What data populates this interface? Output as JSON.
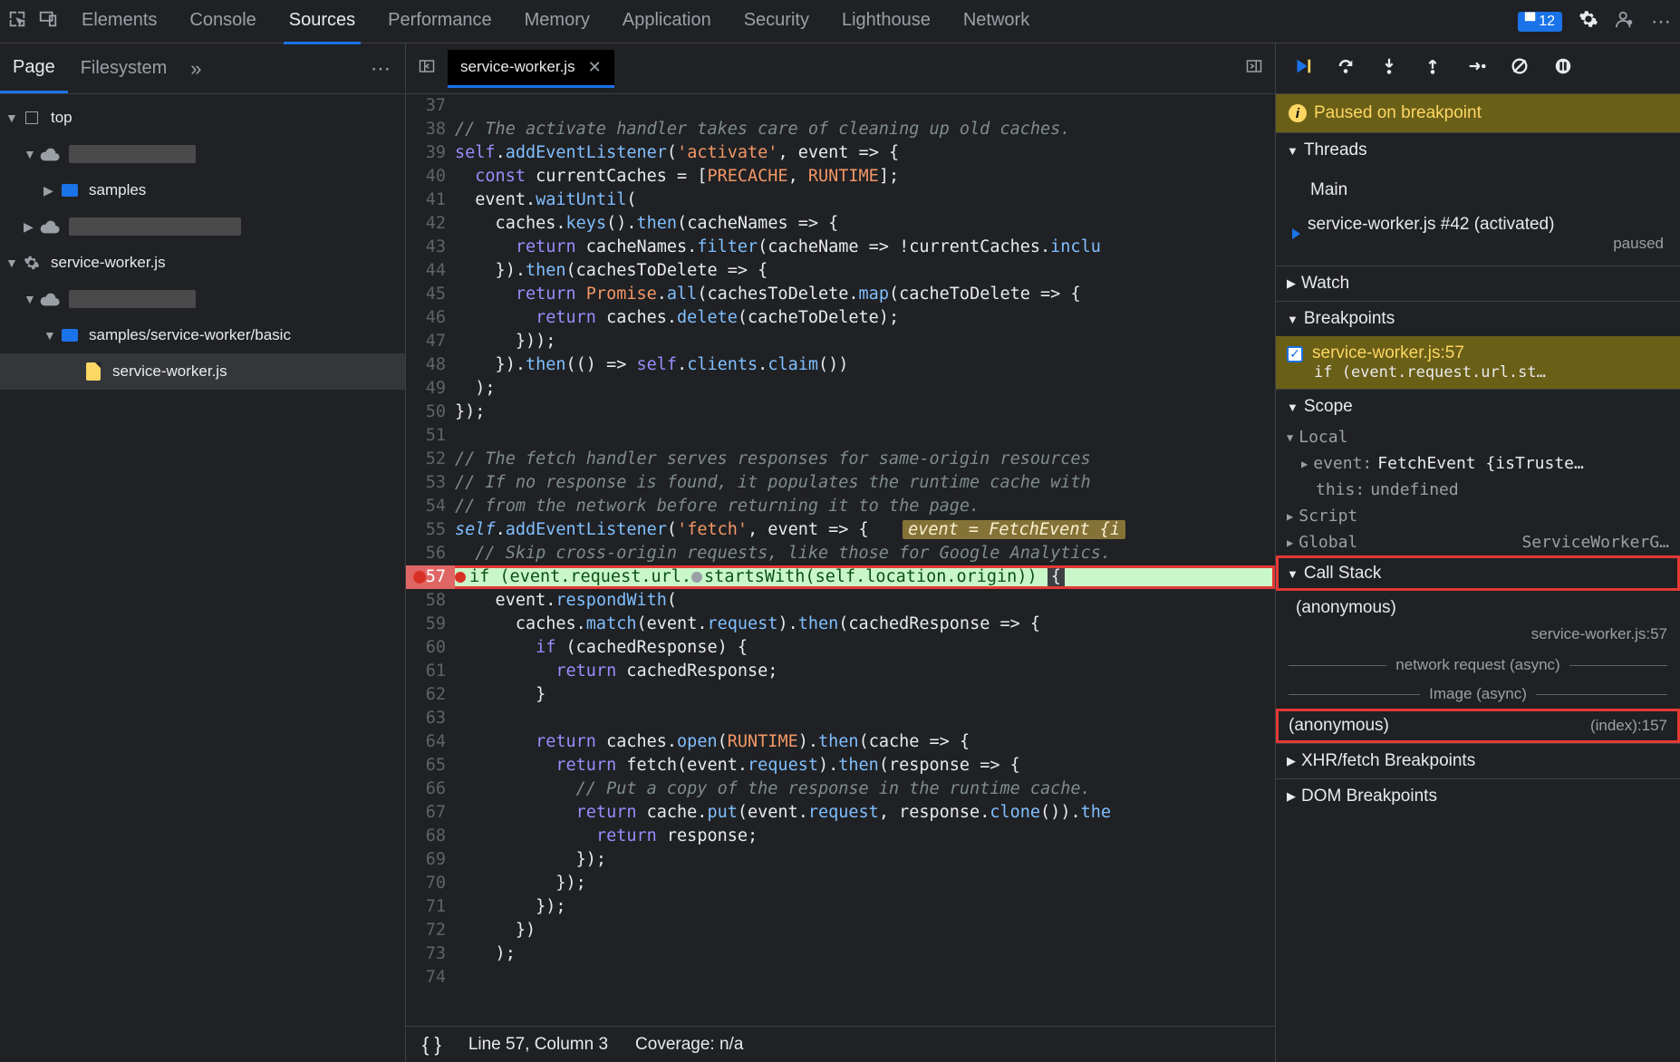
{
  "topTabs": {
    "elements": "Elements",
    "console": "Console",
    "sources": "Sources",
    "performance": "Performance",
    "memory": "Memory",
    "application": "Application",
    "security": "Security",
    "lighthouse": "Lighthouse",
    "network": "Network"
  },
  "issuesBadge": "12",
  "navTabs": {
    "page": "Page",
    "filesystem": "Filesystem"
  },
  "tree": {
    "top": "top",
    "samples": "samples",
    "sw": "service-worker.js",
    "swPath": "samples/service-worker/basic",
    "swFile": "service-worker.js"
  },
  "editor": {
    "fileTab": "service-worker.js"
  },
  "code": {
    "firstLine": 37,
    "lines": [
      "",
      "// The activate handler takes care of cleaning up old caches.",
      "self.addEventListener('activate', event => {",
      "  const currentCaches = [PRECACHE, RUNTIME];",
      "  event.waitUntil(",
      "    caches.keys().then(cacheNames => {",
      "      return cacheNames.filter(cacheName => !currentCaches.inclu",
      "    }).then(cachesToDelete => {",
      "      return Promise.all(cachesToDelete.map(cacheToDelete => {",
      "        return caches.delete(cacheToDelete);",
      "      }));",
      "    }).then(() => self.clients.claim())",
      "  );",
      "});",
      "",
      "// The fetch handler serves responses for same-origin resources ",
      "// If no response is found, it populates the runtime cache with ",
      "// from the network before returning it to the page.",
      "self.addEventListener('fetch', event => {    event = FetchEvent {i",
      "  // Skip cross-origin requests, like those for Google Analytics.",
      "  if (event.request.url.startsWith(self.location.origin)) {",
      "    event.respondWith(",
      "      caches.match(event.request).then(cachedResponse => {",
      "        if (cachedResponse) {",
      "          return cachedResponse;",
      "        }",
      "",
      "        return caches.open(RUNTIME).then(cache => {",
      "          return fetch(event.request).then(response => {",
      "            // Put a copy of the response in the runtime cache.",
      "            return cache.put(event.request, response.clone()).the",
      "              return response;",
      "            });",
      "          });",
      "        });",
      "      })",
      "    );",
      ""
    ],
    "breakpointLine": 57,
    "inlineValueLine": 55,
    "inlineValue": "event = FetchEvent {i"
  },
  "statusBar": {
    "pos": "Line 57, Column 3",
    "coverage": "Coverage: n/a"
  },
  "debug": {
    "pausedMsg": "Paused on breakpoint",
    "threadsTitle": "Threads",
    "mainThread": "Main",
    "workerThread": "service-worker.js #42 (activated)",
    "workerStatus": "paused",
    "watchTitle": "Watch",
    "breakpointsTitle": "Breakpoints",
    "bpFile": "service-worker.js:57",
    "bpCode": "    if (event.request.url.st…",
    "scopeTitle": "Scope",
    "scope": {
      "local": "Local",
      "eventKey": "event:",
      "eventVal": "FetchEvent {isTruste…",
      "thisKey": "this:",
      "thisVal": "undefined",
      "script": "Script",
      "global": "Global",
      "globalVal": "ServiceWorkerG…"
    },
    "callStackTitle": "Call Stack",
    "csFrame1": "(anonymous)",
    "csLoc1": "service-worker.js:57",
    "async1": "network request (async)",
    "async2": "Image (async)",
    "csFrame2": "(anonymous)",
    "csLoc2": "(index):157",
    "xhrTitle": "XHR/fetch Breakpoints",
    "domTitle": "DOM Breakpoints"
  }
}
